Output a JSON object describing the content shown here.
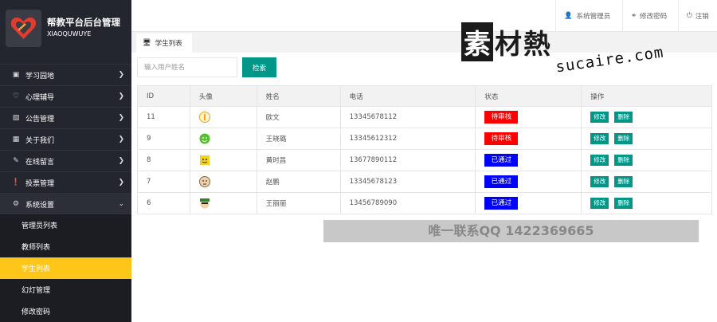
{
  "brand": {
    "title": "帮教平台后台管理",
    "subtitle": "XIAOQUWUYE"
  },
  "header": {
    "admin": "系统管理员",
    "change_password": "修改密码",
    "logout": "注销"
  },
  "sidebar": {
    "items": [
      {
        "label": "学习园地",
        "icon": "bag-icon"
      },
      {
        "label": "心理辅导",
        "icon": "heart-icon"
      },
      {
        "label": "公告管理",
        "icon": "bar-chart-icon"
      },
      {
        "label": "关于我们",
        "icon": "building-icon"
      },
      {
        "label": "在线留言",
        "icon": "message-icon"
      },
      {
        "label": "投票管理",
        "icon": "alert-icon"
      },
      {
        "label": "系统设置",
        "icon": "gear-icon"
      }
    ],
    "sub_items": [
      {
        "label": "管理员列表"
      },
      {
        "label": "教师列表"
      },
      {
        "label": "学生列表",
        "active": true
      },
      {
        "label": "幻灯管理"
      },
      {
        "label": "修改密码"
      }
    ]
  },
  "tab": {
    "label": "学生列表"
  },
  "search": {
    "placeholder": "输入用户姓名",
    "button": "检索"
  },
  "table": {
    "headers": [
      "ID",
      "头像",
      "姓名",
      "电话",
      "状态",
      "操作"
    ],
    "rows": [
      {
        "id": "11",
        "name": "欧文",
        "phone": "13345678112",
        "status": "待审核",
        "status_type": "pending",
        "avatar_color": "#f4a21c"
      },
      {
        "id": "9",
        "name": "王晓璐",
        "phone": "13345612312",
        "status": "待审核",
        "status_type": "pending",
        "avatar_color": "#55c12a"
      },
      {
        "id": "8",
        "name": "黄时昌",
        "phone": "13677890112",
        "status": "已通过",
        "status_type": "passed",
        "avatar_color": "#f3d21c"
      },
      {
        "id": "7",
        "name": "赵鹏",
        "phone": "13345678123",
        "status": "已通过",
        "status_type": "passed",
        "avatar_color": "#e8b98a"
      },
      {
        "id": "6",
        "name": "王丽丽",
        "phone": "13456789090",
        "status": "已通过",
        "status_type": "passed",
        "avatar_color": "#3a7c2c"
      }
    ],
    "edit_label": "修改",
    "delete_label": "删除"
  },
  "watermark": {
    "chars": [
      "素",
      "材",
      "熱"
    ],
    "url": "sucaire.com"
  },
  "contact": "唯一联系QQ 1422369665",
  "colors": {
    "sidebar": "#23262e",
    "accent": "#009688",
    "active": "#ffc61a",
    "pending": "#ff0000",
    "passed": "#0000ff"
  }
}
